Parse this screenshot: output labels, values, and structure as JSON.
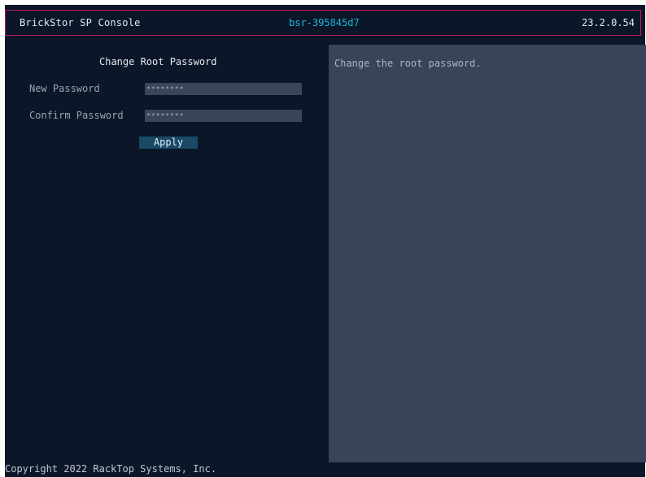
{
  "header": {
    "app_title": "BrickStor SP Console",
    "hostname": "bsr-395845d7",
    "version": "23.2.0.54"
  },
  "form": {
    "title": "Change Root Password",
    "new_password_label": "New Password",
    "new_password_value": "********",
    "confirm_password_label": "Confirm Password",
    "confirm_password_value": "********",
    "apply_label": "Apply"
  },
  "help": {
    "text": "Change the root password."
  },
  "footer": {
    "copyright": "Copyright 2022 RackTop Systems, Inc."
  },
  "colors": {
    "background": "#0b1628",
    "header_border": "#c01a5e",
    "hostname": "#1bb6d6",
    "panel": "#39445a",
    "button": "#1a4a66"
  }
}
